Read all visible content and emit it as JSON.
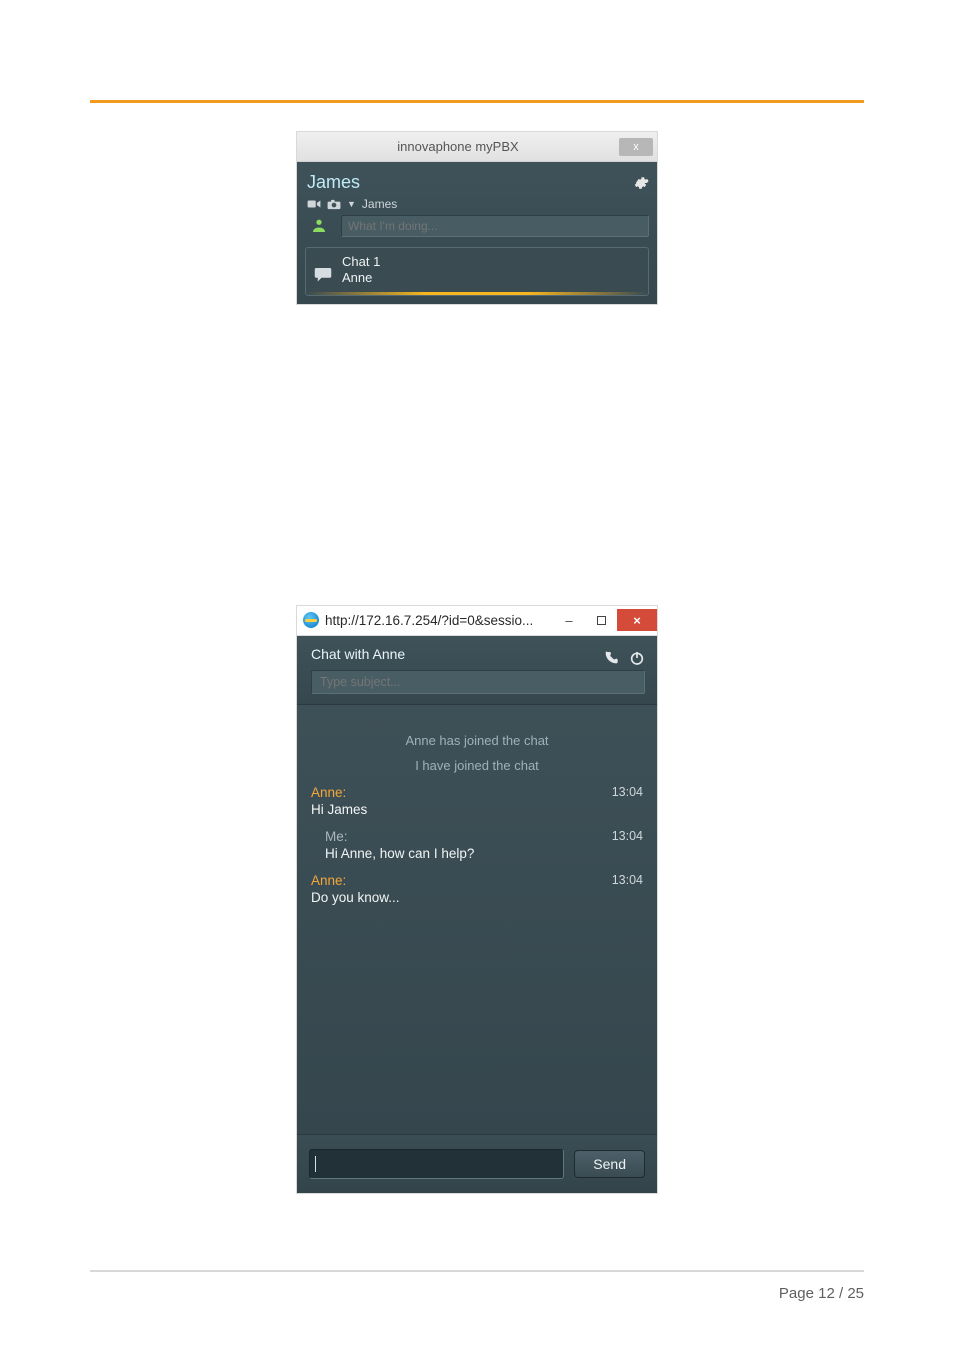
{
  "page": {
    "label_prefix": "Page",
    "current": 12,
    "total": 25
  },
  "panel1": {
    "window_title": "innovaphone myPBX",
    "close_glyph": "x",
    "username": "James",
    "dropdown_label": "James",
    "status_placeholder": "What I'm doing...",
    "chat": {
      "title": "Chat 1",
      "participant": "Anne"
    }
  },
  "panel2": {
    "url": "http://172.16.7.254/?id=0&sessio...",
    "win_min": "–",
    "win_close": "×",
    "chat_title": "Chat with Anne",
    "subject_placeholder": "Type subject...",
    "system_messages": [
      "Anne has joined the chat",
      "I have joined the chat"
    ],
    "messages": [
      {
        "from": "Anne",
        "from_label": "Anne:",
        "time": "13:04",
        "body": "Hi James"
      },
      {
        "from": "Me",
        "from_label": "Me:",
        "time": "13:04",
        "body": "Hi Anne, how can I help?"
      },
      {
        "from": "Anne",
        "from_label": "Anne:",
        "time": "13:04",
        "body": "Do you know..."
      }
    ],
    "send_label": "Send"
  }
}
